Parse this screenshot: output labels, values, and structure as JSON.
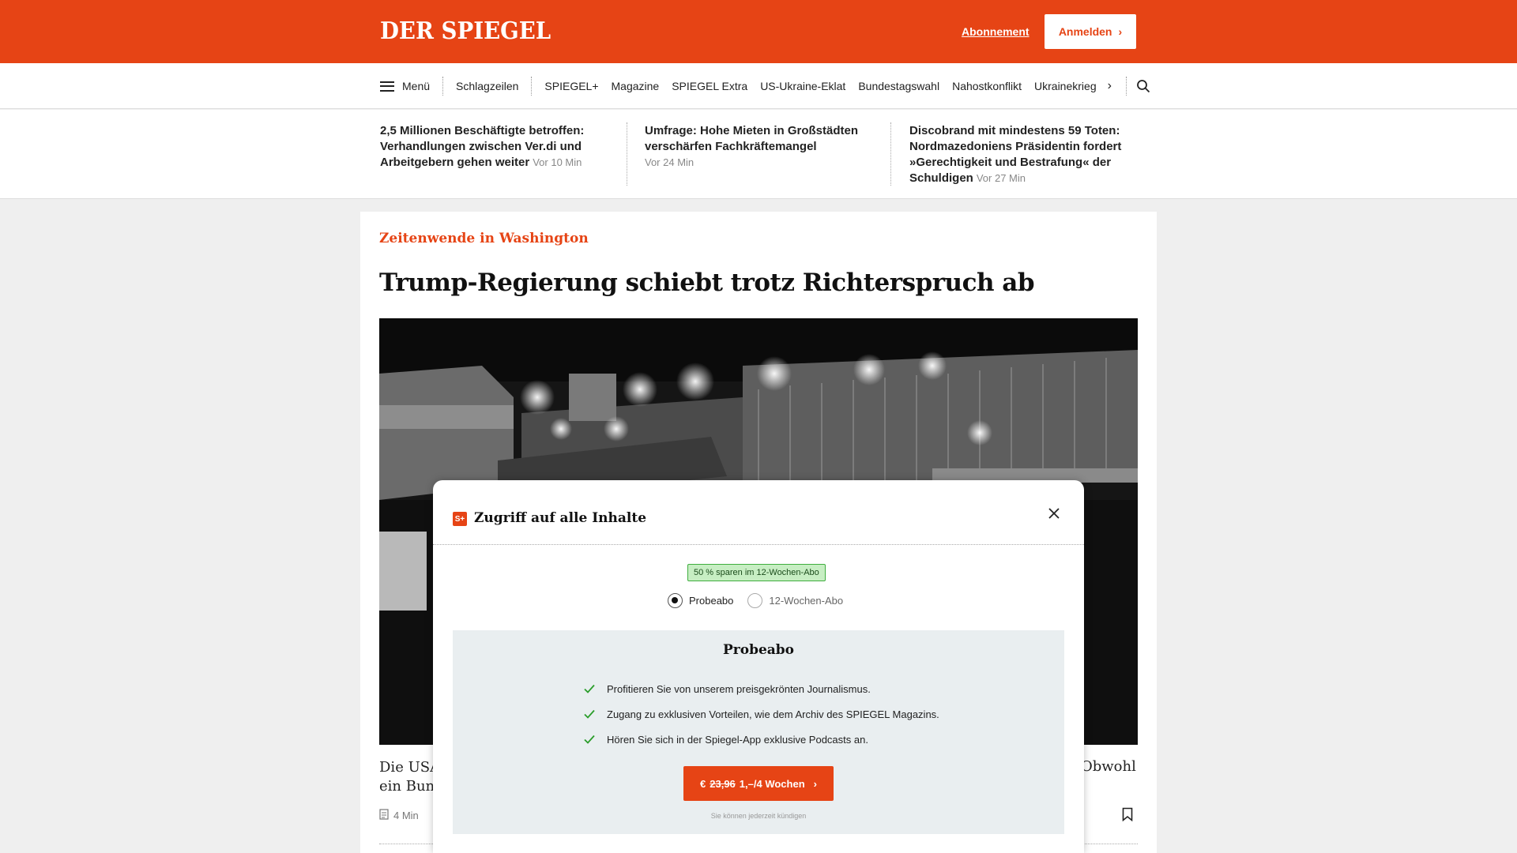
{
  "header": {
    "logo": "DER SPIEGEL",
    "abo_link": "Abonnement",
    "login_label": "Anmelden",
    "brand_color": "#e64415"
  },
  "nav": {
    "menu_label": "Menü",
    "items": [
      "Schlagzeilen",
      "SPIEGEL+",
      "Magazine",
      "SPIEGEL Extra",
      "US-Ukraine-Eklat",
      "Bundestagswahl",
      "Nahostkonflikt",
      "Ukrainekrieg"
    ],
    "more_icon": "chevron-right-icon",
    "search_icon": "search-icon"
  },
  "teasers": [
    {
      "title": "2,5 Millionen Beschäftigte betroffen: Verhandlungen zwischen Ver.di und Arbeitgebern gehen weiter",
      "time": "Vor 10 Min"
    },
    {
      "title": "Umfrage: Hohe Mieten in Großstädten verschärfen Fachkräftemangel",
      "time": "Vor 24 Min"
    },
    {
      "title": "Discobrand mit mindestens 59 Toten: Nordmazedoniens Präsidentin fordert »Gerechtigkeit und Bestrafung« der Schuldigen",
      "time": "Vor 27 Min"
    }
  ],
  "article": {
    "kicker": "Zeitenwende in Washington",
    "headline": "Trump-Regierung schiebt trotz Richterspruch ab",
    "teaser_left_line1": "Die USA",
    "teaser_left_line2": "ein Bund",
    "teaser_right": "Obwohl",
    "read_time": "4 Min"
  },
  "modal": {
    "badge": "S+",
    "title": "Zugriff auf alle Inhalte",
    "save_badge": "50 % sparen im 12-Wochen-Abo",
    "options": [
      {
        "label": "Probeabo",
        "selected": true
      },
      {
        "label": "12-Wochen-Abo",
        "selected": false
      }
    ],
    "offer_title": "Probeabo",
    "benefits": [
      "Profitieren Sie von unserem preisgekrönten Journalismus.",
      "Zugang zu exklusiven Vorteilen, wie dem Archiv des SPIEGEL Magazins.",
      "Hören Sie sich in der Spiegel-App exklusive Podcasts an."
    ],
    "cta_currency": "€",
    "cta_old_price": "23,96",
    "cta_new_price": "1,–/4 Wochen",
    "cancel_note": "Sie können jederzeit kündigen"
  }
}
